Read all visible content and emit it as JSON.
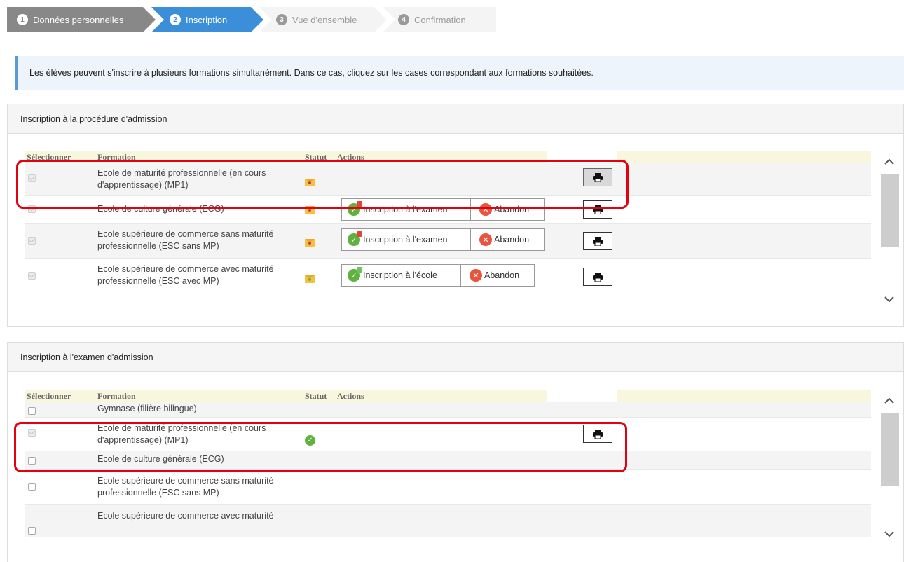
{
  "stepper": {
    "steps": [
      {
        "num": "1",
        "label": "Données personnelles",
        "state": "done"
      },
      {
        "num": "2",
        "label": "Inscription",
        "state": "active"
      },
      {
        "num": "3",
        "label": "Vue d'ensemble",
        "state": "pending"
      },
      {
        "num": "4",
        "label": "Confirmation",
        "state": "pending"
      }
    ]
  },
  "info": {
    "text": "Les élèves peuvent s'inscrire à plusieurs formations simultanément. Dans ce cas, cliquez sur les cases correspondant aux formations souhaitées."
  },
  "table_headers": {
    "select": "Sélectionner",
    "formation": "Formation",
    "status": "Statut",
    "actions": "Actions"
  },
  "procedure_panel": {
    "title": "Inscription à la procédure d'admission",
    "rows": [
      {
        "formation": "Ecole de maturité professionnelle (en cours d'apprentissage) (MP1)",
        "checkbox": "checked-disabled",
        "status_icon": "envelope-red-icon"
      },
      {
        "formation": "Ecole de culture générale (ECG)",
        "checkbox": "checked-disabled",
        "status_icon": "envelope-red-icon",
        "action_primary": "Inscription à l'examen",
        "action_secondary": "Abandon"
      },
      {
        "formation": "Ecole supérieure de commerce sans maturité professionnelle (ESC sans MP)",
        "checkbox": "checked-disabled",
        "status_icon": "envelope-red-icon",
        "action_primary": "Inscription à l'examen",
        "action_secondary": "Abandon"
      },
      {
        "formation": "Ecole supérieure de commerce avec maturité professionnelle (ESC avec MP)",
        "checkbox": "checked-disabled",
        "status_icon": "envelope-green-icon",
        "action_primary": "Inscription à l'école",
        "action_secondary": "Abandon"
      }
    ]
  },
  "exam_panel": {
    "title": "Inscription à l'examen d'admission",
    "rows": [
      {
        "formation": "Gymnase (filière bilingue)",
        "checkbox": "unchecked"
      },
      {
        "formation": "Ecole de maturité professionnelle (en cours d'apprentissage) (MP1)",
        "checkbox": "checked-disabled",
        "status_icon": "check-circle-icon"
      },
      {
        "formation": "Ecole de culture générale (ECG)",
        "checkbox": "unchecked"
      },
      {
        "formation": "Ecole supérieure de commerce sans maturité professionnelle (ESC sans MP)",
        "checkbox": "unchecked"
      },
      {
        "formation": "Ecole supérieure de commerce avec maturité",
        "checkbox": "unchecked"
      }
    ]
  },
  "icons": {
    "print": "printer-icon",
    "scroll_up": "chevron-up-icon",
    "scroll_down": "chevron-down-icon"
  },
  "colors": {
    "active_step": "#3a8fd8",
    "done_step": "#888888",
    "highlight": "#e3000f",
    "info_border": "#5b9bd5"
  }
}
